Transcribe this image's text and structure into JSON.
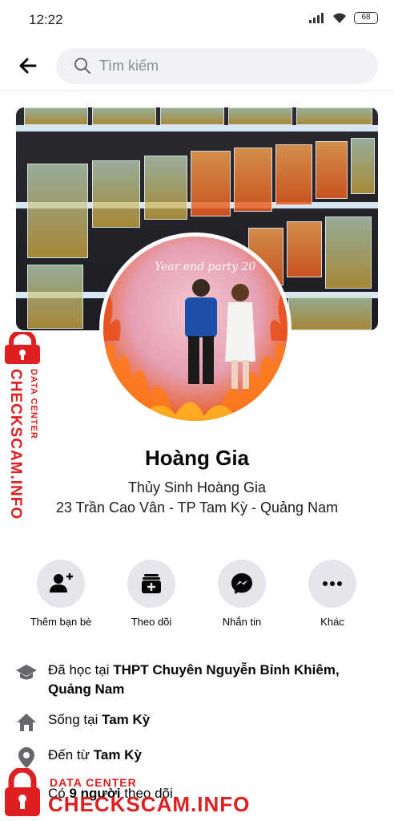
{
  "status_bar": {
    "time": "12:22",
    "battery": "68"
  },
  "search": {
    "placeholder": "Tìm kiếm"
  },
  "profile": {
    "name": "Hoàng Gia",
    "bio_line1": "Thủy Sinh Hoàng Gia",
    "bio_line2": "23 Trần Cao Vân - TP Tam Kỳ - Quảng Nam",
    "avatar_text": "Year end party 20"
  },
  "actions": [
    {
      "label": "Thêm bạn bè",
      "icon": "add-friend-icon"
    },
    {
      "label": "Theo dõi",
      "icon": "follow-icon"
    },
    {
      "label": "Nhắn tin",
      "icon": "messenger-icon"
    },
    {
      "label": "Khác",
      "icon": "more-icon"
    }
  ],
  "details": {
    "education_prefix": "Đã học tại ",
    "education_school": "THPT Chuyên Nguyễn Bỉnh Khiêm,",
    "education_place": "Quảng Nam",
    "lives_prefix": "Sống tại ",
    "lives_place": "Tam Kỳ",
    "from_prefix": "Đến từ ",
    "from_place": "Tam Kỳ",
    "followers_prefix": "Có ",
    "followers_count": "9 người",
    "followers_suffix": " theo dõi"
  },
  "watermark": {
    "small": "DATA CENTER",
    "main": "CHECKSCAM.INFO"
  },
  "colors": {
    "accent": "#1877f2",
    "watermark": "#e02020",
    "button_bg": "#e4e6eb"
  }
}
